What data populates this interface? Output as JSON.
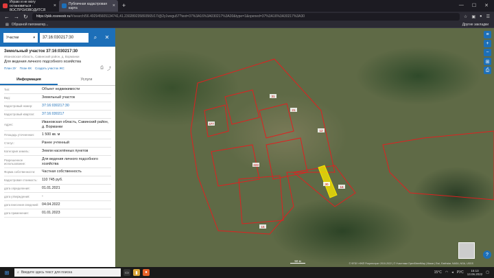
{
  "browser": {
    "tabs": [
      {
        "title": "Играю и не могу остановиться · ВОСПРОИЗВОДИТСЯ",
        "color": "#e33b3b",
        "active": false
      },
      {
        "title": "Публичная кадастровая карта",
        "color": "#1d6fb8",
        "active": true
      }
    ],
    "new_tab": "+",
    "url_host": "https://pkk.rosreestr.ru",
    "url_path": "/#/search/56.492945605134741,41.230289235893565/17/@2y1wvgu57?text=37%3A16%3A030217%3A30&type=1&opened=37%3A16%3A30217%3A30",
    "bookmark": "Образной пиломатер...",
    "other_bookmarks": "Другие закладки"
  },
  "panel": {
    "search_type": "Участки",
    "search_value": "37:16:030217:30",
    "title": "Земельный участок 37:16:030217:30",
    "address": "Ивановская область, Савинский район, д. Ворманки",
    "use": "Для ведения личного подсобного хозяйства",
    "links": [
      "План ЗУ",
      "План КК",
      "Создать участок ЖС"
    ],
    "tabs": [
      "Информация",
      "Услуги"
    ],
    "rows": [
      {
        "k": "Тип:",
        "v": "Объект недвижимости",
        "link": false
      },
      {
        "k": "Вид:",
        "v": "Земельный участок",
        "link": false
      },
      {
        "k": "Кадастровый номер:",
        "v": "37:16:030217:30",
        "link": true
      },
      {
        "k": "Кадастровый квартал:",
        "v": "37:16:030217",
        "link": true
      },
      {
        "k": "Адрес:",
        "v": "Ивановская область, Савинский район, д. Ворманки",
        "link": false
      },
      {
        "k": "Площадь уточненная:",
        "v": "1 500 кв. м",
        "link": false
      },
      {
        "k": "Статус:",
        "v": "Ранее учтенный",
        "link": false
      },
      {
        "k": "Категория земель:",
        "v": "Земли населённых пунктов",
        "link": false
      },
      {
        "k": "Разрешенное использование:",
        "v": "Для ведения личного подсобного хозяйства",
        "link": false
      },
      {
        "k": "Форма собственности:",
        "v": "Частная собственность",
        "link": false
      },
      {
        "k": "Кадастровая стоимость:",
        "v": "110 745 руб.",
        "link": false
      },
      {
        "k": "дата определения:",
        "v": "01.01.2021",
        "link": false
      },
      {
        "k": "дата утверждения:",
        "v": "-",
        "link": false
      },
      {
        "k": "дата внесения сведений:",
        "v": "04.04.2022",
        "link": false
      },
      {
        "k": "дата применения:",
        "v": "01.01.2023",
        "link": false
      }
    ]
  },
  "map": {
    "scale": "50 м",
    "attribution": "© ФГБУ «ФКП Росреестра» 2010-2022 | © Участники OpenStreetMap | Maxar | Esri, Earthstar, NASA, NGA, USGS",
    "parcel_labels": [
      "30",
      "477",
      "223",
      "31",
      "12",
      "21",
      "15",
      "16"
    ],
    "outline_color": "#e02020",
    "selected_color": "#f5e400"
  },
  "taskbar": {
    "search_placeholder": "Введите здесь текст для поиска",
    "weather": "15°C",
    "lang": "РУС",
    "time": "15:13",
    "date": "13.06.2022"
  }
}
